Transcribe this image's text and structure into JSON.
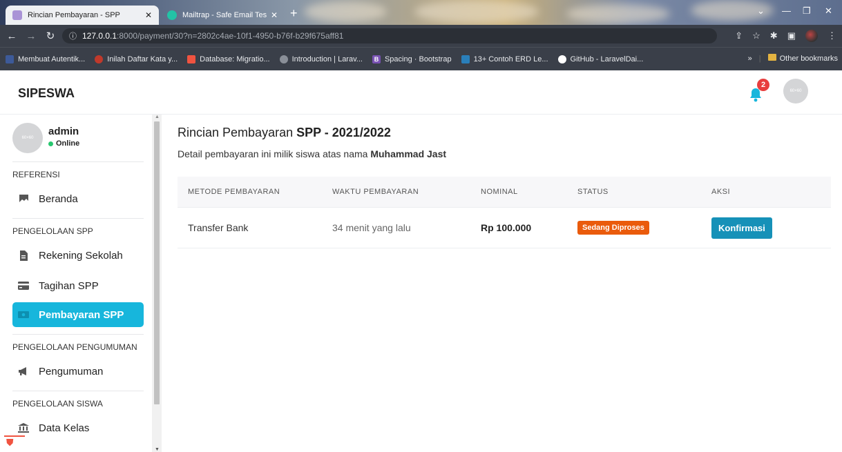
{
  "browser": {
    "tabs": [
      {
        "title": "Rincian Pembayaran - SPP",
        "active": true
      },
      {
        "title": "Mailtrap - Safe Email Testing",
        "active": false
      }
    ],
    "url_host": "127.0.0.1",
    "url_path": ":8000/payment/30?n=2802c4ae-10f1-4950-b76f-b29f675aff81",
    "bookmarks": [
      {
        "label": "Membuat Autentik...",
        "color": "#3d5a99"
      },
      {
        "label": "Inilah Daftar Kata y...",
        "color": "#c0392b"
      },
      {
        "label": "Database: Migratio...",
        "color": "#f05340"
      },
      {
        "label": "Introduction | Larav...",
        "color": "#8a8f98"
      },
      {
        "label": "Spacing · Bootstrap",
        "color": "#7952b3"
      },
      {
        "label": "13+ Contoh ERD Le...",
        "color": "#2a7fba"
      },
      {
        "label": "GitHub - LaravelDai...",
        "color": "#ffffff"
      }
    ],
    "other_bookmarks": "Other bookmarks",
    "more": "»"
  },
  "header": {
    "brand": "SIPESWA",
    "notification_count": "2",
    "avatar_text": "60×60"
  },
  "sidebar": {
    "profile": {
      "name": "admin",
      "status": "Online",
      "avatar_text": "60×60"
    },
    "sections": [
      {
        "title": "REFERENSI"
      },
      {
        "title": "PENGELOLAAN SPP"
      },
      {
        "title": "PENGELOLAAN PENGUMUMAN"
      },
      {
        "title": "PENGELOLAAN SISWA"
      }
    ],
    "items": [
      {
        "label": "Beranda",
        "icon": "dashboard-icon"
      },
      {
        "label": "Rekening Sekolah",
        "icon": "file-icon"
      },
      {
        "label": "Tagihan SPP",
        "icon": "card-icon"
      },
      {
        "label": "Pembayaran SPP",
        "icon": "money-icon",
        "active": true
      },
      {
        "label": "Pengumuman",
        "icon": "megaphone-icon"
      },
      {
        "label": "Data Kelas",
        "icon": "building-icon"
      }
    ]
  },
  "main": {
    "title_prefix": "Rincian Pembayaran ",
    "title_bold": "SPP - 2021/2022",
    "subtitle_prefix": "Detail pembayaran ini milik siswa atas nama ",
    "subtitle_bold": "Muhammad Jast",
    "table": {
      "headers": [
        "METODE PEMBAYARAN",
        "WAKTU PEMBAYARAN",
        "NOMINAL",
        "STATUS",
        "AKSI"
      ],
      "rows": [
        {
          "method": "Transfer Bank",
          "time": "34 menit yang lalu",
          "nominal": "Rp 100.000",
          "status": "Sedang Diproses",
          "action": "Konfirmasi"
        }
      ]
    }
  },
  "colors": {
    "accent": "#17b6dc",
    "status_processing": "#ea5b0c",
    "confirm_button": "#1691b8",
    "badge": "#e83e3e"
  }
}
